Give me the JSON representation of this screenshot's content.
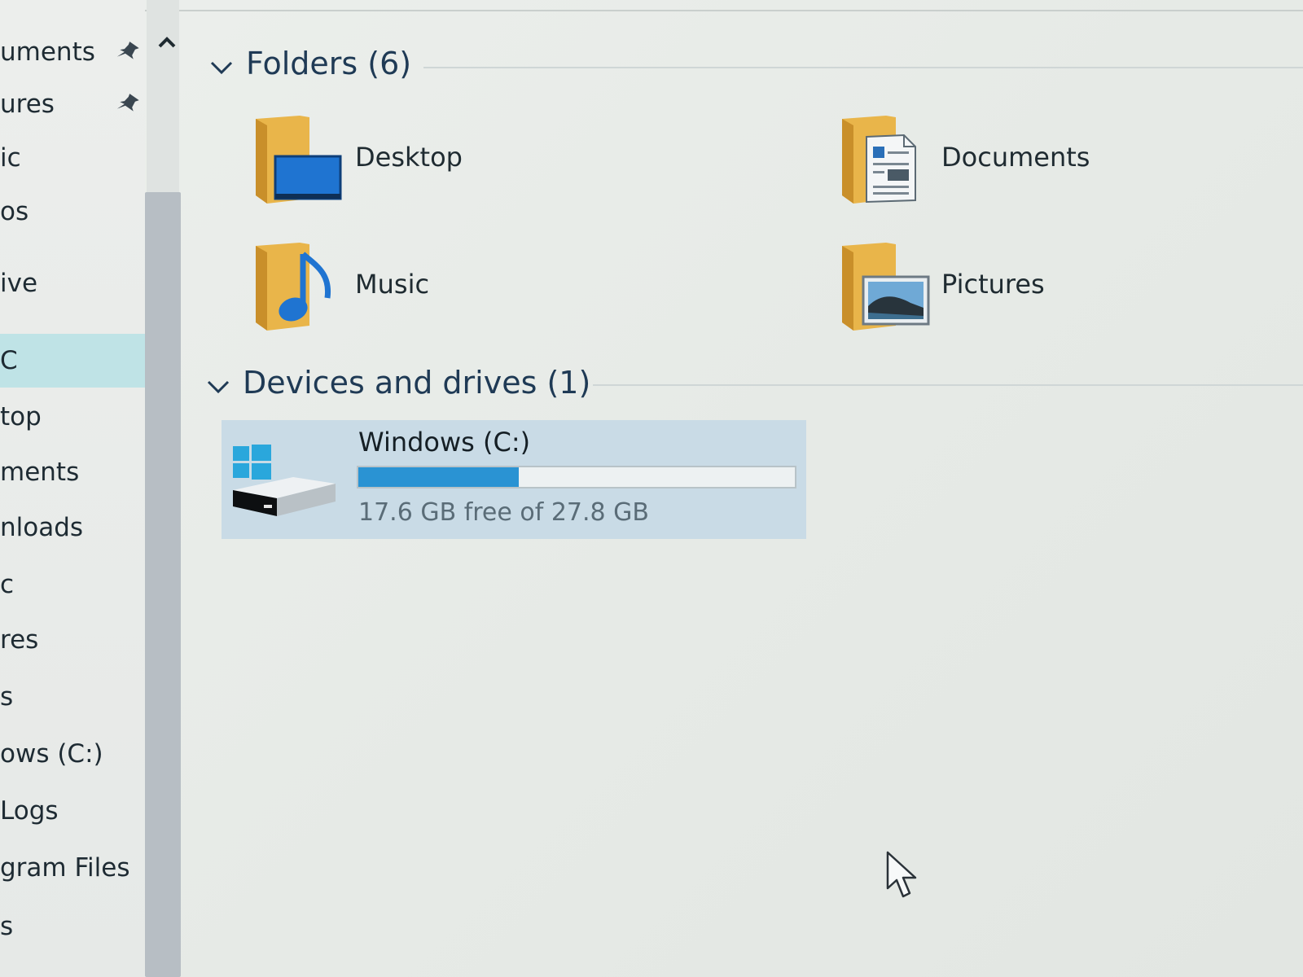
{
  "sidebar": {
    "items": [
      {
        "label": "uments",
        "pinned": true
      },
      {
        "label": "ures",
        "pinned": true
      },
      {
        "label": "ic"
      },
      {
        "label": "os"
      },
      {
        "label": "ive"
      },
      {
        "label": "C",
        "selected": true
      },
      {
        "label": "top"
      },
      {
        "label": "ments"
      },
      {
        "label": "nloads"
      },
      {
        "label": "c"
      },
      {
        "label": "res"
      },
      {
        "label": "s"
      },
      {
        "label": "ows (C:)"
      },
      {
        "label": "Logs"
      },
      {
        "label": "gram Files"
      },
      {
        "label": "s"
      }
    ]
  },
  "folders_section": {
    "title": "Folders (6)",
    "items": [
      {
        "name": "Desktop",
        "icon": "desktop-folder-icon"
      },
      {
        "name": "Documents",
        "icon": "documents-folder-icon"
      },
      {
        "name": "Music",
        "icon": "music-folder-icon"
      },
      {
        "name": "Pictures",
        "icon": "pictures-folder-icon"
      }
    ]
  },
  "devices_section": {
    "title": "Devices and drives (1)",
    "drives": [
      {
        "name": "Windows (C:)",
        "free_text": "17.6 GB free of 27.8 GB",
        "used_fraction": 0.367,
        "icon": "windows-drive-icon"
      }
    ]
  },
  "colors": {
    "accent": "#2a93d3",
    "selection": "#bfe3e6",
    "drive_highlight": "#c9dbe6",
    "folder": "#e9b54a"
  }
}
